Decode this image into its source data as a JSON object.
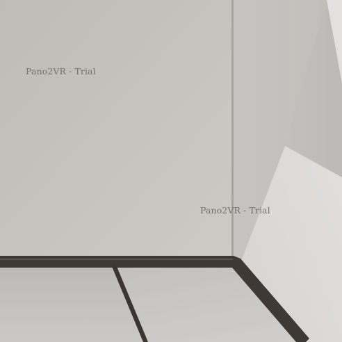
{
  "viewer": {
    "watermarks": [
      {
        "text": "Pano2VR - Trial"
      },
      {
        "text": "Pano2VR - Trial"
      }
    ]
  },
  "colors": {
    "left_wall": "#c4c0bc",
    "right_wall_shadow": "#c2bebb",
    "right_wall_light": "#e2dfdc",
    "floor": "#c3c1bf",
    "baseboard": "#3e3935",
    "watermark": "#6e6a66"
  }
}
